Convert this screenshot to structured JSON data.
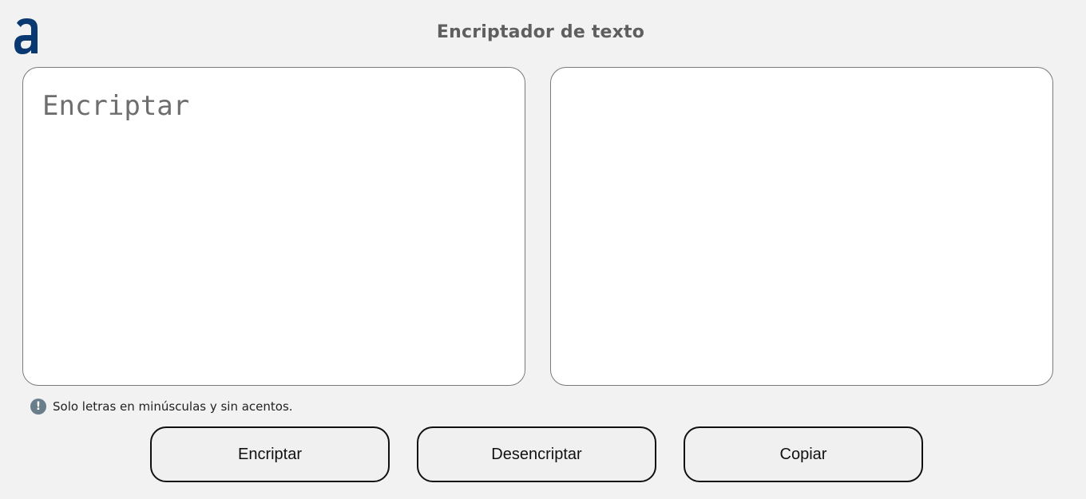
{
  "logo": {
    "icon": "alura-logo-icon",
    "color": "#0a3871"
  },
  "header": {
    "title": "Encriptador de texto"
  },
  "input": {
    "placeholder": "Encriptar",
    "value": ""
  },
  "output": {
    "value": ""
  },
  "hint": {
    "icon": "exclamation-icon",
    "text": "Solo letras en minúsculas y sin acentos."
  },
  "buttons": {
    "encrypt_label": "Encriptar",
    "decrypt_label": "Desencriptar",
    "copy_label": "Copiar"
  }
}
